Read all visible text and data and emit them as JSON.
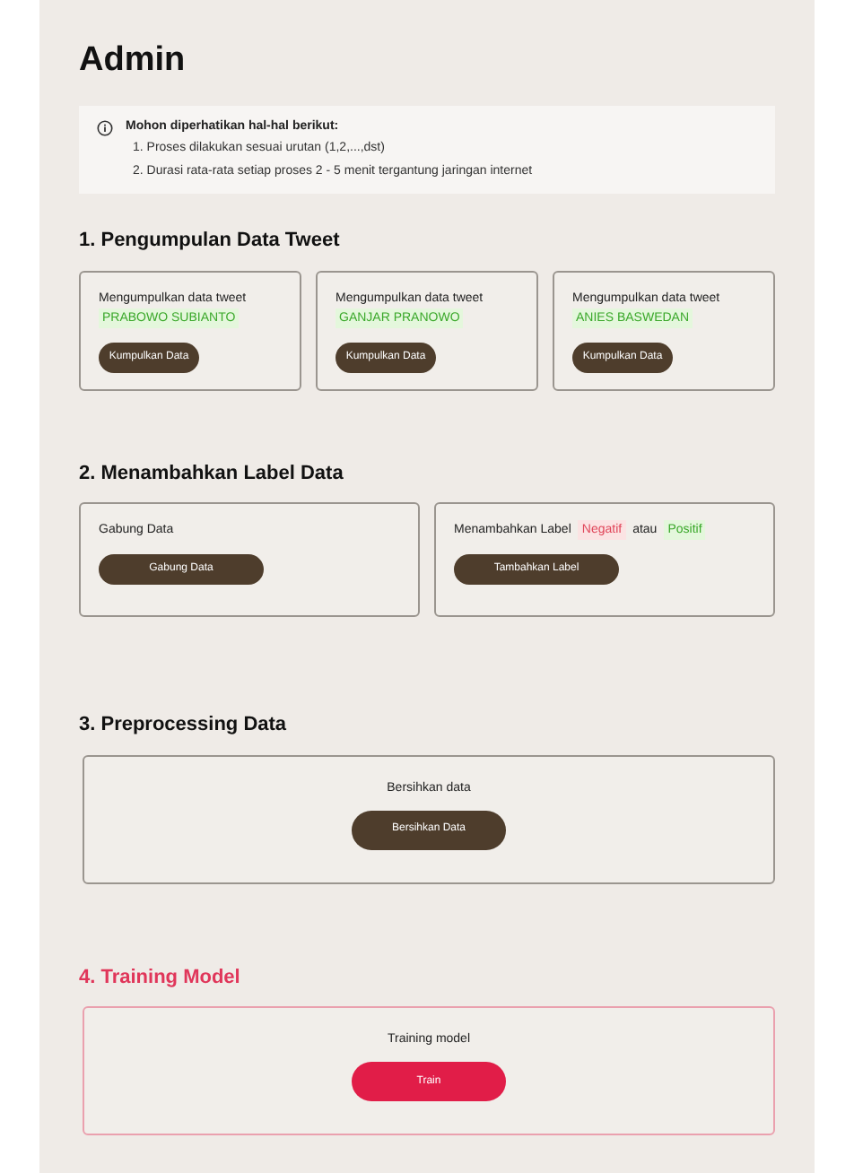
{
  "title": "Admin",
  "notice": {
    "heading": "Mohon diperhatikan hal-hal berikut:",
    "items": [
      "1. Proses dilakukan sesuai urutan (1,2,...,dst)",
      "2. Durasi rata-rata setiap proses 2 - 5 menit tergantung jaringan internet"
    ]
  },
  "sections": [
    {
      "heading": "1. Pengumpulan Data Tweet",
      "accent": false,
      "kind": "columns",
      "cards": [
        {
          "text": [
            {
              "kind": "plain",
              "text": "Mengumpulkan data tweet"
            },
            {
              "kind": "positive",
              "text": "PRABOWO SUBIANTO"
            }
          ],
          "button": "Kumpulkan Data"
        },
        {
          "text": [
            {
              "kind": "plain",
              "text": "Mengumpulkan data tweet"
            },
            {
              "kind": "positive",
              "text": "GANJAR PRANOWO"
            }
          ],
          "button": "Kumpulkan Data"
        },
        {
          "text": [
            {
              "kind": "plain",
              "text": "Mengumpulkan data tweet"
            },
            {
              "kind": "positive",
              "text": "ANIES BASWEDAN"
            }
          ],
          "button": "Kumpulkan Data"
        }
      ]
    },
    {
      "heading": "2. Menambahkan Label Data",
      "accent": false,
      "kind": "columns",
      "cards": [
        {
          "text": [
            {
              "kind": "plain",
              "text": "Gabung Data"
            }
          ],
          "button": "Gabung Data"
        },
        {
          "text": [
            {
              "kind": "plain",
              "text": "Menambahkan Label"
            },
            {
              "kind": "negative",
              "text": "Negatif"
            },
            {
              "kind": "plain",
              "text": "atau"
            },
            {
              "kind": "positive",
              "text": "Positif"
            }
          ],
          "button": "Tambahkan Label"
        }
      ]
    },
    {
      "heading": "3. Preprocessing Data",
      "accent": false,
      "kind": "centered",
      "cards": [
        {
          "text": [
            {
              "kind": "plain",
              "text": "Bersihkan data"
            }
          ],
          "button": "Bersihkan Data"
        }
      ]
    },
    {
      "heading": "4. Training Model",
      "accent": true,
      "kind": "centered",
      "cards": [
        {
          "text": [
            {
              "kind": "plain",
              "text": "Training model"
            }
          ],
          "button": "Train"
        }
      ]
    }
  ]
}
